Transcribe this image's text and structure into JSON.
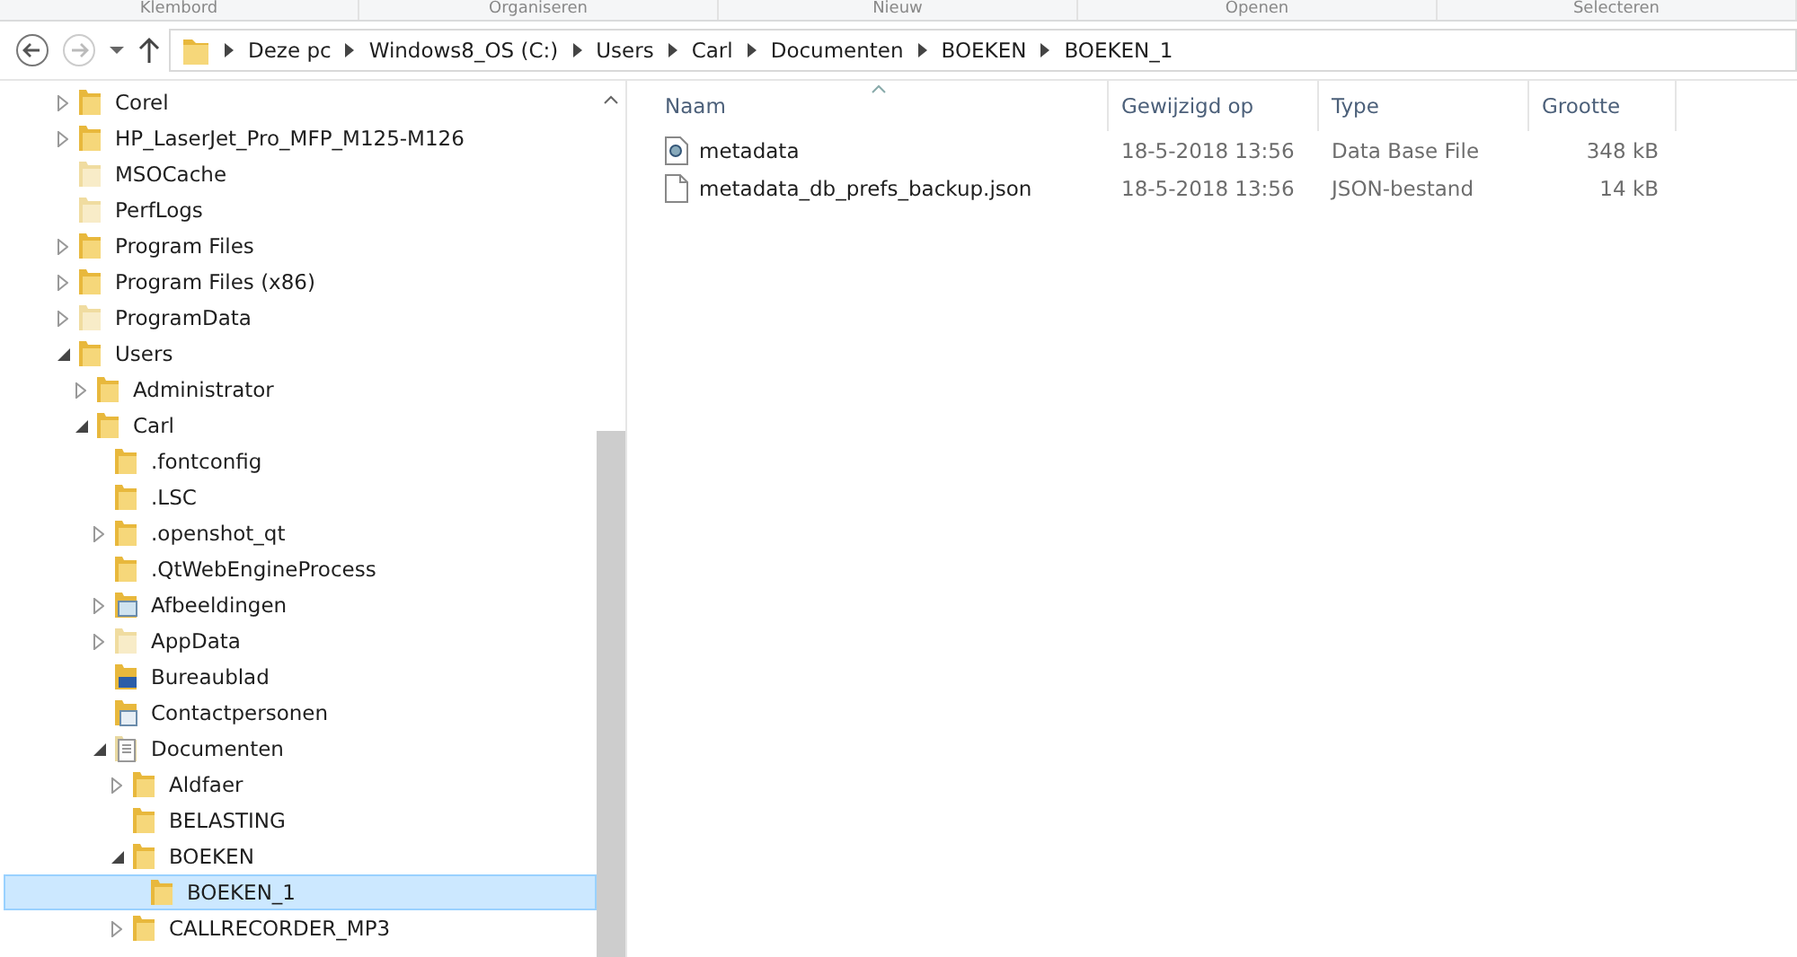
{
  "ribbon_groups": [
    "Klembord",
    "Organiseren",
    "Nieuw",
    "Openen",
    "Selecteren"
  ],
  "address_bar": {
    "crumbs": [
      "Deze pc",
      "Windows8_OS (C:)",
      "Users",
      "Carl",
      "Documenten",
      "BOEKEN",
      "BOEKEN_1"
    ]
  },
  "tree": [
    {
      "label": "Corel",
      "kind": "folder",
      "expandable": true,
      "expanded": false,
      "selected": false
    },
    {
      "label": "HP_LaserJet_Pro_MFP_M125-M126",
      "kind": "folder",
      "expandable": true,
      "expanded": false,
      "selected": false
    },
    {
      "label": "MSOCache",
      "kind": "hidden",
      "expandable": false,
      "selected": false
    },
    {
      "label": "PerfLogs",
      "kind": "hidden",
      "expandable": false,
      "selected": false
    },
    {
      "label": "Program Files",
      "kind": "folder",
      "expandable": true,
      "expanded": false,
      "selected": false
    },
    {
      "label": "Program Files (x86)",
      "kind": "folder",
      "expandable": true,
      "expanded": false,
      "selected": false
    },
    {
      "label": "ProgramData",
      "kind": "hidden",
      "expandable": true,
      "expanded": false,
      "selected": false
    },
    {
      "label": "Users",
      "kind": "folder",
      "expandable": true,
      "expanded": true,
      "selected": false,
      "children": [
        {
          "label": "Administrator",
          "kind": "folder",
          "expandable": true,
          "expanded": false,
          "selected": false
        },
        {
          "label": "Carl",
          "kind": "folder",
          "expandable": true,
          "expanded": true,
          "selected": false,
          "children": [
            {
              "label": ".fontconfig",
              "kind": "folder",
              "expandable": false,
              "selected": false
            },
            {
              "label": ".LSC",
              "kind": "folder",
              "expandable": false,
              "selected": false
            },
            {
              "label": ".openshot_qt",
              "kind": "folder",
              "expandable": true,
              "expanded": false,
              "selected": false
            },
            {
              "label": ".QtWebEngineProcess",
              "kind": "folder",
              "expandable": false,
              "selected": false
            },
            {
              "label": "Afbeeldingen",
              "kind": "pictures",
              "expandable": true,
              "expanded": false,
              "selected": false
            },
            {
              "label": "AppData",
              "kind": "hidden",
              "expandable": true,
              "expanded": false,
              "selected": false
            },
            {
              "label": "Bureaublad",
              "kind": "desktop",
              "expandable": false,
              "selected": false
            },
            {
              "label": "Contactpersonen",
              "kind": "contacts",
              "expandable": false,
              "selected": false
            },
            {
              "label": "Documenten",
              "kind": "documents",
              "expandable": true,
              "expanded": true,
              "selected": false,
              "children": [
                {
                  "label": "Aldfaer",
                  "kind": "folder",
                  "expandable": true,
                  "expanded": false,
                  "selected": false
                },
                {
                  "label": "BELASTING",
                  "kind": "folder",
                  "expandable": false,
                  "selected": false
                },
                {
                  "label": "BOEKEN",
                  "kind": "folder",
                  "expandable": true,
                  "expanded": true,
                  "selected": false,
                  "children": [
                    {
                      "label": "BOEKEN_1",
                      "kind": "folder",
                      "expandable": false,
                      "selected": true
                    }
                  ]
                },
                {
                  "label": "CALLRECORDER_MP3",
                  "kind": "folder",
                  "expandable": true,
                  "expanded": false,
                  "selected": false
                }
              ]
            }
          ]
        }
      ]
    }
  ],
  "file_list": {
    "columns": [
      "Naam",
      "Gewijzigd op",
      "Type",
      "Grootte"
    ],
    "rows": [
      {
        "name": "metadata",
        "kind": "database",
        "modified": "18-5-2018 13:56",
        "type": "Data Base File",
        "size": "348 kB"
      },
      {
        "name": "metadata_db_prefs_backup.json",
        "kind": "file",
        "modified": "18-5-2018 13:56",
        "type": "JSON-bestand",
        "size": "14 kB"
      }
    ]
  }
}
